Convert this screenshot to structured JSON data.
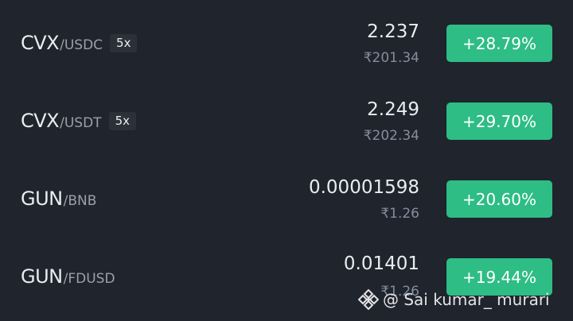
{
  "markets": [
    {
      "base": "CVX",
      "quote": "/USDC",
      "leverage": "5x",
      "price": "2.237",
      "fiat": "₹201.34",
      "change": "+28.79%"
    },
    {
      "base": "CVX",
      "quote": "/USDT",
      "leverage": "5x",
      "price": "2.249",
      "fiat": "₹202.34",
      "change": "+29.70%"
    },
    {
      "base": "GUN",
      "quote": "/BNB",
      "leverage": null,
      "price": "0.00001598",
      "fiat": "₹1.26",
      "change": "+20.60%"
    },
    {
      "base": "GUN",
      "quote": "/FDUSD",
      "leverage": null,
      "price": "0.01401",
      "fiat": "₹1.26",
      "change": "+19.44%"
    }
  ],
  "watermark": {
    "icon": "binance-logo-icon",
    "text": "@ Sai kumar_ murari"
  },
  "colors": {
    "background": "#1f242d",
    "positive": "#2ebd85",
    "badge": "#2b3139",
    "muted": "#848e9c"
  }
}
